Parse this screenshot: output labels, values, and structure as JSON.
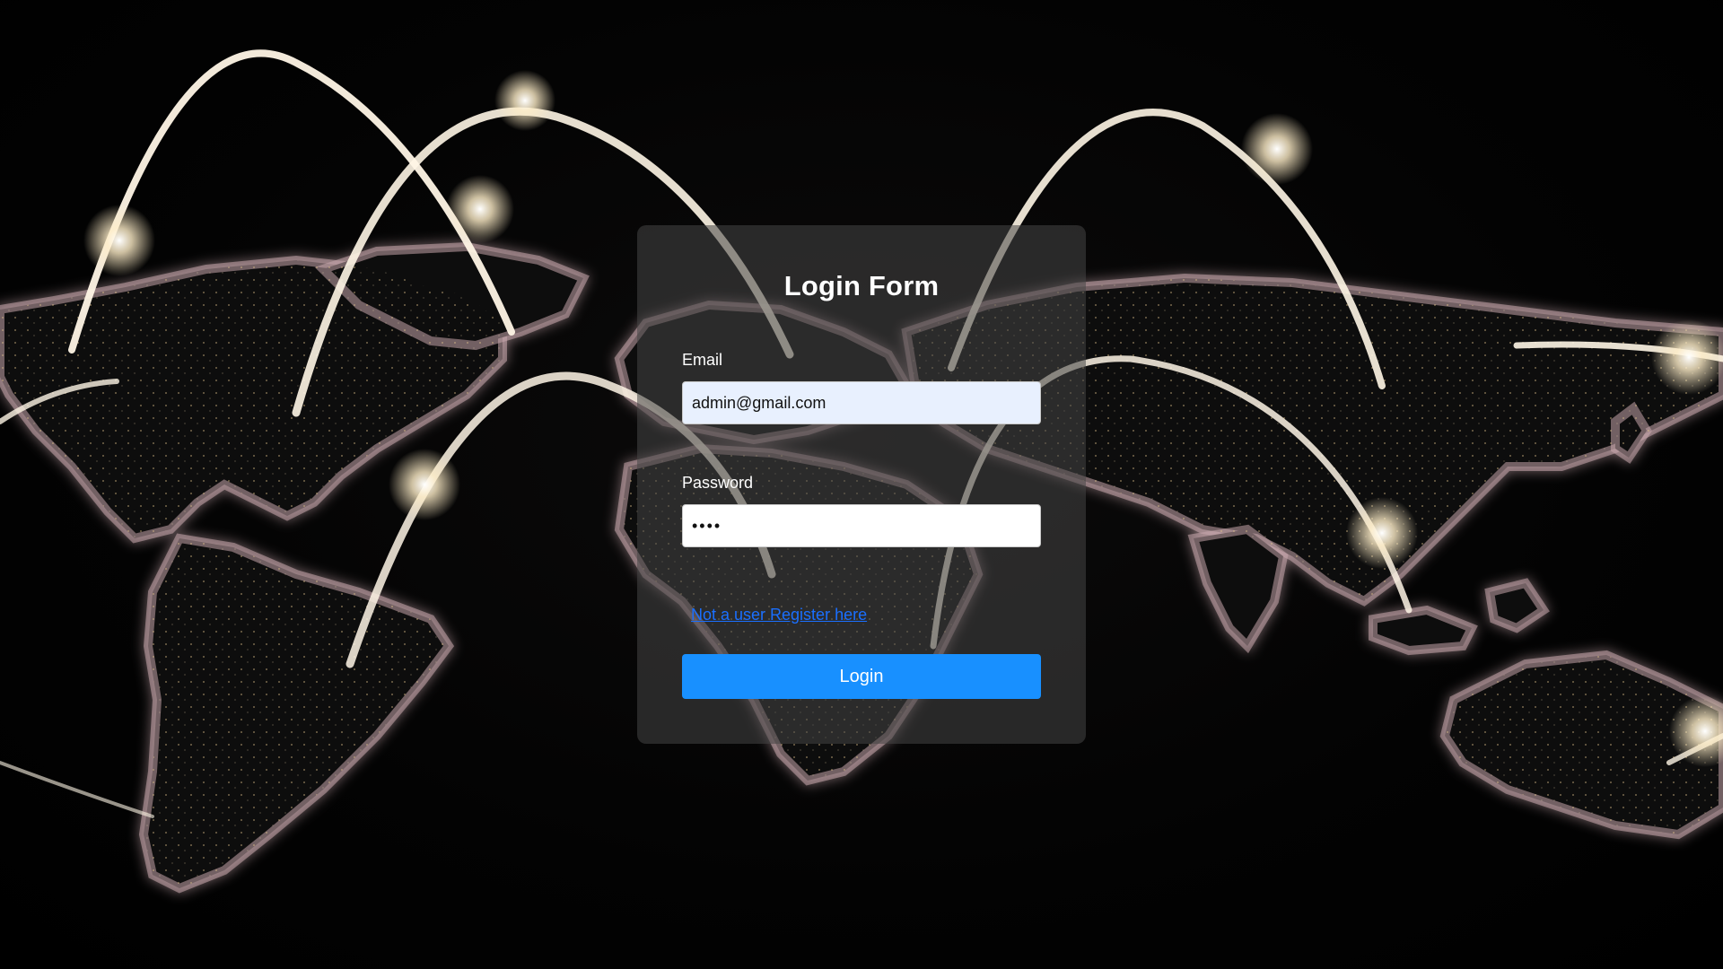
{
  "background": {
    "icon": "world-map-connections-icon",
    "colors": {
      "land_glow": "#c9a7ad",
      "arc": "#fff6e6",
      "city_lights": "#f5d9a8"
    }
  },
  "login_form": {
    "title": "Login Form",
    "email": {
      "label": "Email",
      "value": "admin@gmail.com"
    },
    "password": {
      "label": "Password",
      "value": "••••"
    },
    "register_link": "Not a user Register here",
    "login_button": "Login",
    "colors": {
      "button": "#1890ff",
      "link": "#1a6fff"
    }
  }
}
